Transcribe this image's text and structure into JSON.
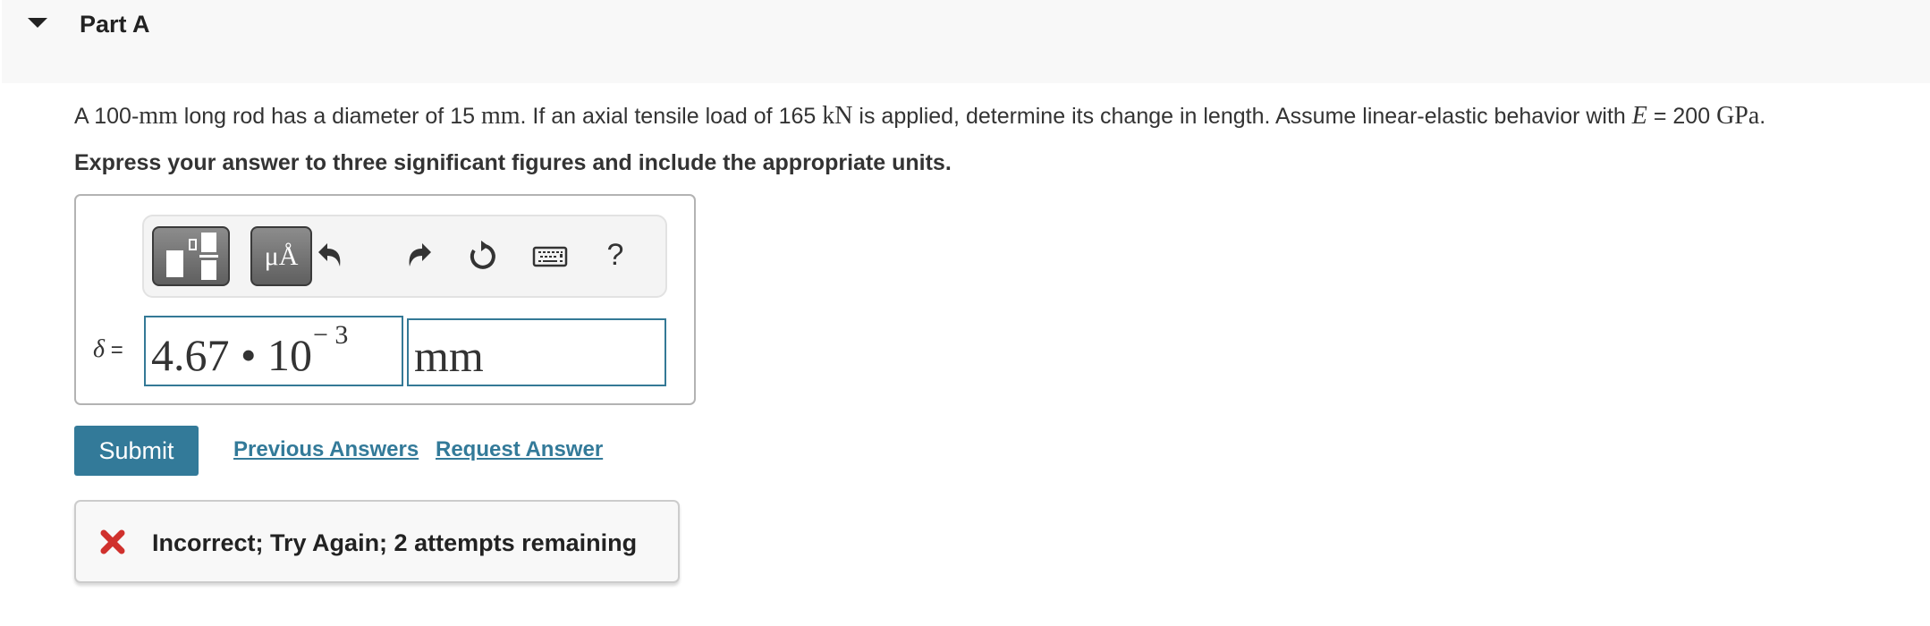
{
  "part": {
    "title": "Part A",
    "expanded": true
  },
  "problem": {
    "segments": [
      {
        "text": "A 100-",
        "style": "text"
      },
      {
        "text": "mm",
        "style": "math"
      },
      {
        "text": " long rod has a diameter of 15 ",
        "style": "text"
      },
      {
        "text": "mm",
        "style": "math"
      },
      {
        "text": ". If an axial tensile load of 165 ",
        "style": "text"
      },
      {
        "text": " kN",
        "style": "math"
      },
      {
        "text": " is applied, determine its change in length. Assume linear-elastic behavior with ",
        "style": "text"
      },
      {
        "text": "E",
        "style": "math-italic"
      },
      {
        "text": " = 200 ",
        "style": "text"
      },
      {
        "text": "GPa",
        "style": "math"
      },
      {
        "text": ".",
        "style": "text"
      }
    ],
    "instructions": "Express your answer to three significant figures and include the appropriate units."
  },
  "toolbar": {
    "templates_icon": "templates-icon",
    "units_label": "μÅ",
    "undo_icon": "undo-icon",
    "redo_icon": "redo-icon",
    "reset_icon": "reset-icon",
    "keyboard_icon": "keyboard-icon",
    "help_label": "?"
  },
  "answer": {
    "variable": "δ",
    "equals": "=",
    "value_mantissa": "4.67 • 10",
    "value_exponent": "− 3",
    "units": "mm"
  },
  "actions": {
    "submit_label": "Submit",
    "previous_answers_label": "Previous Answers",
    "request_answer_label": "Request Answer"
  },
  "feedback": {
    "status": "incorrect",
    "icon": "x-icon",
    "message": "Incorrect; Try Again; 2 attempts remaining",
    "icon_color": "#d0312d"
  },
  "colors": {
    "accent": "#337a99",
    "header_bg": "#f8f8f8",
    "text": "#333333"
  }
}
